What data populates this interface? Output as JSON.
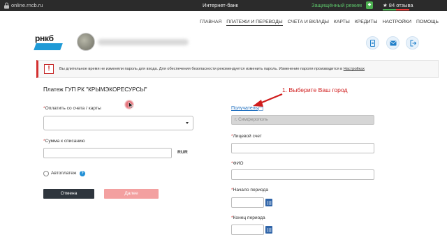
{
  "browser": {
    "url": "online.rncb.ru",
    "title": "Интернет-банк",
    "secure_mode": "Защищённый режим",
    "reviews": "★ 84 отзыва"
  },
  "nav": {
    "items": [
      "ГЛАВНАЯ",
      "ПЛАТЕЖИ И ПЕРЕВОДЫ",
      "СЧЕТА И ВКЛАДЫ",
      "КАРТЫ",
      "КРЕДИТЫ",
      "НАСТРОЙКИ",
      "ПОМОЩЬ"
    ],
    "active_index": 1
  },
  "header": {
    "logo_text": "рнкб",
    "icons": [
      "document-icon",
      "mail-icon",
      "logout-icon"
    ]
  },
  "alert": {
    "icon": "!",
    "text": "Вы длительное время не изменяли пароль для входа. Для обеспечения безопасности рекомендуется изменить пароль. Изменение пароля производится в ",
    "link": "Настройках"
  },
  "form": {
    "title": "Платеж ГУП РК \"КРЫМЭКОРЕСУРСЫ\"",
    "pay_from_label": "Оплатить со счета / карты",
    "amount_label": "Сумма к списанию",
    "currency": "RUR",
    "autopay_label": "Автоплатеж",
    "help_mark": "?",
    "cancel_label": "Отмена",
    "next_label": "Далее"
  },
  "right": {
    "payee_label": "Получатель",
    "city_value": "г. Симферополь",
    "account_label": "Лицевой счет",
    "fio_label": "ФИО",
    "period_start_label": "Начало периода",
    "period_end_label": "Конец периода"
  },
  "annotation": {
    "text": "1. Выберите Ваш город"
  },
  "colors": {
    "accent_blue": "#1f9ad6",
    "link_blue": "#1f6fbf",
    "required_red": "#d32f2f",
    "annotation_red": "#d01c1c",
    "cancel_button": "#2e353d",
    "next_button_disabled": "#f3a0a0",
    "calendar_blue": "#2f64a8"
  }
}
